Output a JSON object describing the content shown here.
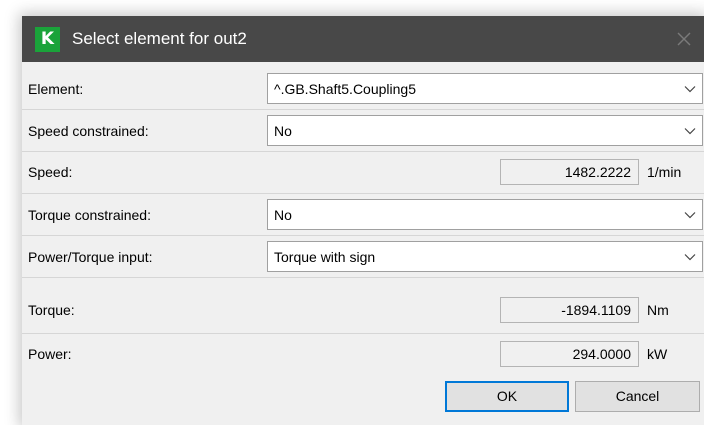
{
  "window": {
    "app_icon_letter": "K",
    "title": "Select element for out2",
    "accent_color": "#1aa33a",
    "titlebar_color": "#484848"
  },
  "form": {
    "element": {
      "label": "Element:",
      "value": "^.GB.Shaft5.Coupling5"
    },
    "speed_constrained": {
      "label": "Speed constrained:",
      "value": "No"
    },
    "speed": {
      "label": "Speed:",
      "value": "1482.2222",
      "unit": "1/min"
    },
    "torque_constrained": {
      "label": "Torque constrained:",
      "value": "No"
    },
    "power_torque_input": {
      "label": "Power/Torque input:",
      "value": "Torque with sign"
    },
    "torque": {
      "label": "Torque:",
      "value": "-1894.1109",
      "unit": "Nm"
    },
    "power": {
      "label": "Power:",
      "value": "294.0000",
      "unit": "kW"
    }
  },
  "buttons": {
    "ok_label": "OK",
    "cancel_label": "Cancel"
  },
  "icons": {
    "close": "close-icon",
    "dropdown": "chevron-down-icon",
    "app": "app-logo"
  }
}
